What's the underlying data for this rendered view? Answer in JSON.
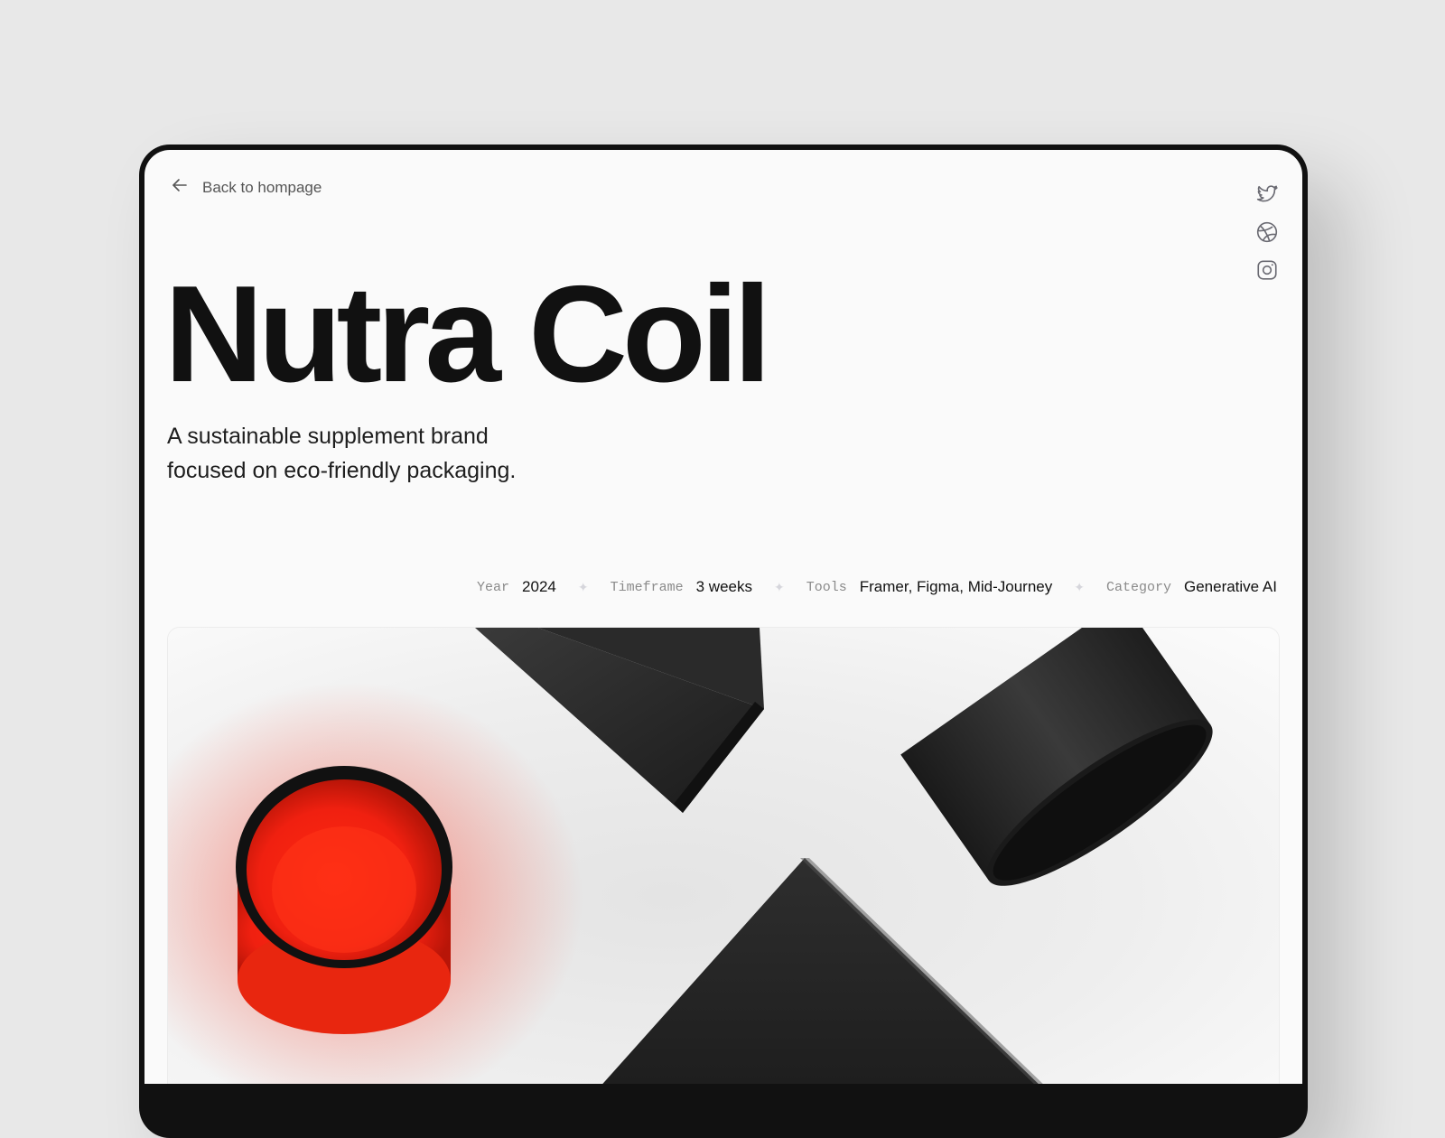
{
  "nav": {
    "back_label": "Back to hompage"
  },
  "socials": [
    {
      "icon": "twitter-icon"
    },
    {
      "icon": "dribbble-icon"
    },
    {
      "icon": "instagram-icon"
    }
  ],
  "project": {
    "title": "Nutra Coil",
    "subtitle": "A sustainable supplement brand focused on eco-friendly packaging."
  },
  "meta": [
    {
      "label": "Year",
      "value": "2024"
    },
    {
      "label": "Timeframe",
      "value": "3 weeks"
    },
    {
      "label": "Tools",
      "value": "Framer, Figma, Mid-Journey"
    },
    {
      "label": "Category",
      "value": "Generative AI"
    }
  ],
  "colors": {
    "background": "#e8e8e8",
    "device_frame": "#111111",
    "screen": "#fafafa",
    "accent_red": "#ff2a12"
  }
}
